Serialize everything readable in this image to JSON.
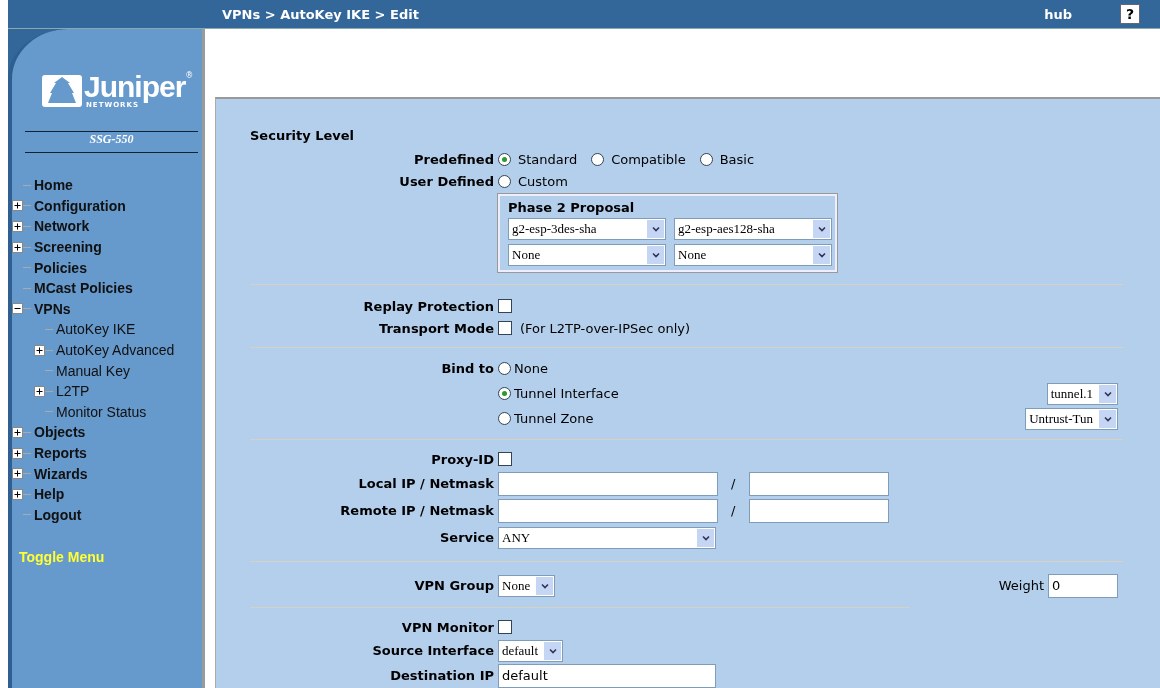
{
  "header": {
    "breadcrumb": "VPNs > AutoKey IKE > Edit",
    "user": "hub",
    "help": "?"
  },
  "sidebar": {
    "logo": {
      "name": "Juniper",
      "mark": "®",
      "sub": "NETWORKS"
    },
    "device": "SSG-550",
    "menu": [
      {
        "label": "Home"
      },
      {
        "label": "Configuration",
        "expanded": false
      },
      {
        "label": "Network",
        "expanded": false
      },
      {
        "label": "Screening",
        "expanded": false
      },
      {
        "label": "Policies"
      },
      {
        "label": "MCast Policies"
      },
      {
        "label": "VPNs",
        "expanded": true,
        "children": [
          {
            "label": "AutoKey IKE"
          },
          {
            "label": "AutoKey Advanced",
            "expanded": false
          },
          {
            "label": "Manual Key"
          },
          {
            "label": "L2TP",
            "expanded": false
          },
          {
            "label": "Monitor Status"
          }
        ]
      },
      {
        "label": "Objects",
        "expanded": false
      },
      {
        "label": "Reports",
        "expanded": false
      },
      {
        "label": "Wizards",
        "expanded": false
      },
      {
        "label": "Help",
        "expanded": false
      },
      {
        "label": "Logout"
      }
    ],
    "toggle": "Toggle Menu"
  },
  "form": {
    "security_level": {
      "title": "Security Level",
      "predefined": {
        "label": "Predefined",
        "options": [
          {
            "label": "Standard",
            "selected": true
          },
          {
            "label": "Compatible",
            "selected": false
          },
          {
            "label": "Basic",
            "selected": false
          }
        ]
      },
      "user_defined": {
        "label": "User Defined",
        "options": [
          {
            "label": "Custom",
            "selected": false
          }
        ]
      },
      "phase2": {
        "title": "Phase 2 Proposal",
        "proposals": [
          "g2-esp-3des-sha",
          "g2-esp-aes128-sha",
          "None",
          "None"
        ]
      }
    },
    "replay_protection": {
      "label": "Replay Protection",
      "checked": false
    },
    "transport_mode": {
      "label": "Transport Mode",
      "checked": false,
      "note": "(For L2TP-over-IPSec only)"
    },
    "bind_to": {
      "label": "Bind to",
      "options": [
        {
          "label": "None",
          "selected": false
        },
        {
          "label": "Tunnel Interface",
          "selected": true,
          "select": "tunnel.1"
        },
        {
          "label": "Tunnel Zone",
          "selected": false,
          "select": "Untrust-Tun"
        }
      ]
    },
    "proxy_id": {
      "label": "Proxy-ID",
      "checked": false
    },
    "local_ip": {
      "label": "Local IP / Netmask",
      "separator": "/"
    },
    "remote_ip": {
      "label": "Remote IP / Netmask",
      "separator": "/"
    },
    "service": {
      "label": "Service",
      "value": "ANY"
    },
    "vpn_group": {
      "label": "VPN Group",
      "value": "None"
    },
    "weight": {
      "label": "Weight",
      "value": "0"
    },
    "vpn_monitor": {
      "label": "VPN Monitor",
      "checked": false
    },
    "source_interface": {
      "label": "Source Interface",
      "value": "default"
    },
    "destination_ip": {
      "label": "Destination IP",
      "value": "default"
    }
  }
}
